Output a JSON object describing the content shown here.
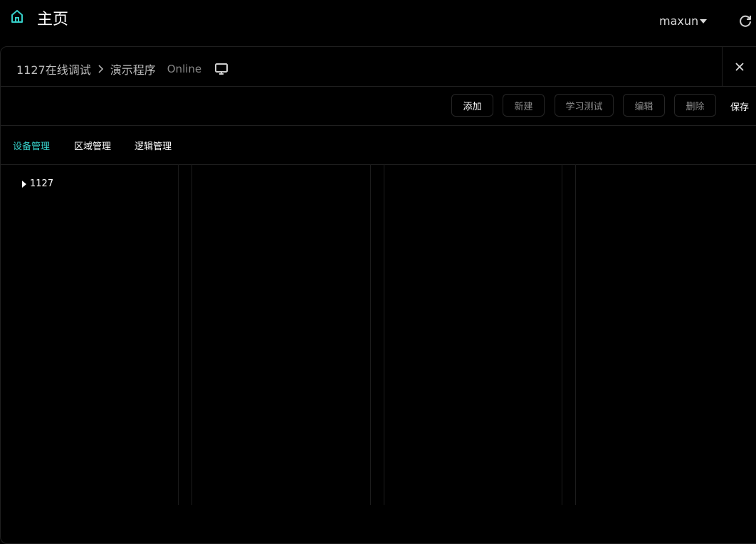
{
  "header": {
    "title": "主页",
    "username": "maxun",
    "icons": {
      "home": "home-icon",
      "refresh": "refresh-icon"
    },
    "accent_color": "#36cfc9"
  },
  "panel": {
    "breadcrumb": [
      "1127在线调试",
      "演示程序"
    ],
    "status": "Online",
    "icons": {
      "separator": "chevron-right-icon",
      "monitor": "monitor-icon",
      "close": "close-icon"
    }
  },
  "toolbar": {
    "add": "添加",
    "new": "新建",
    "learn_test": "学习测试",
    "edit": "编辑",
    "delete": "删除",
    "save": "保存"
  },
  "tabs": [
    {
      "label": "设备管理",
      "active": true
    },
    {
      "label": "区域管理",
      "active": false
    },
    {
      "label": "逻辑管理",
      "active": false
    }
  ],
  "tree": [
    {
      "label": "1127",
      "expanded": false
    }
  ]
}
